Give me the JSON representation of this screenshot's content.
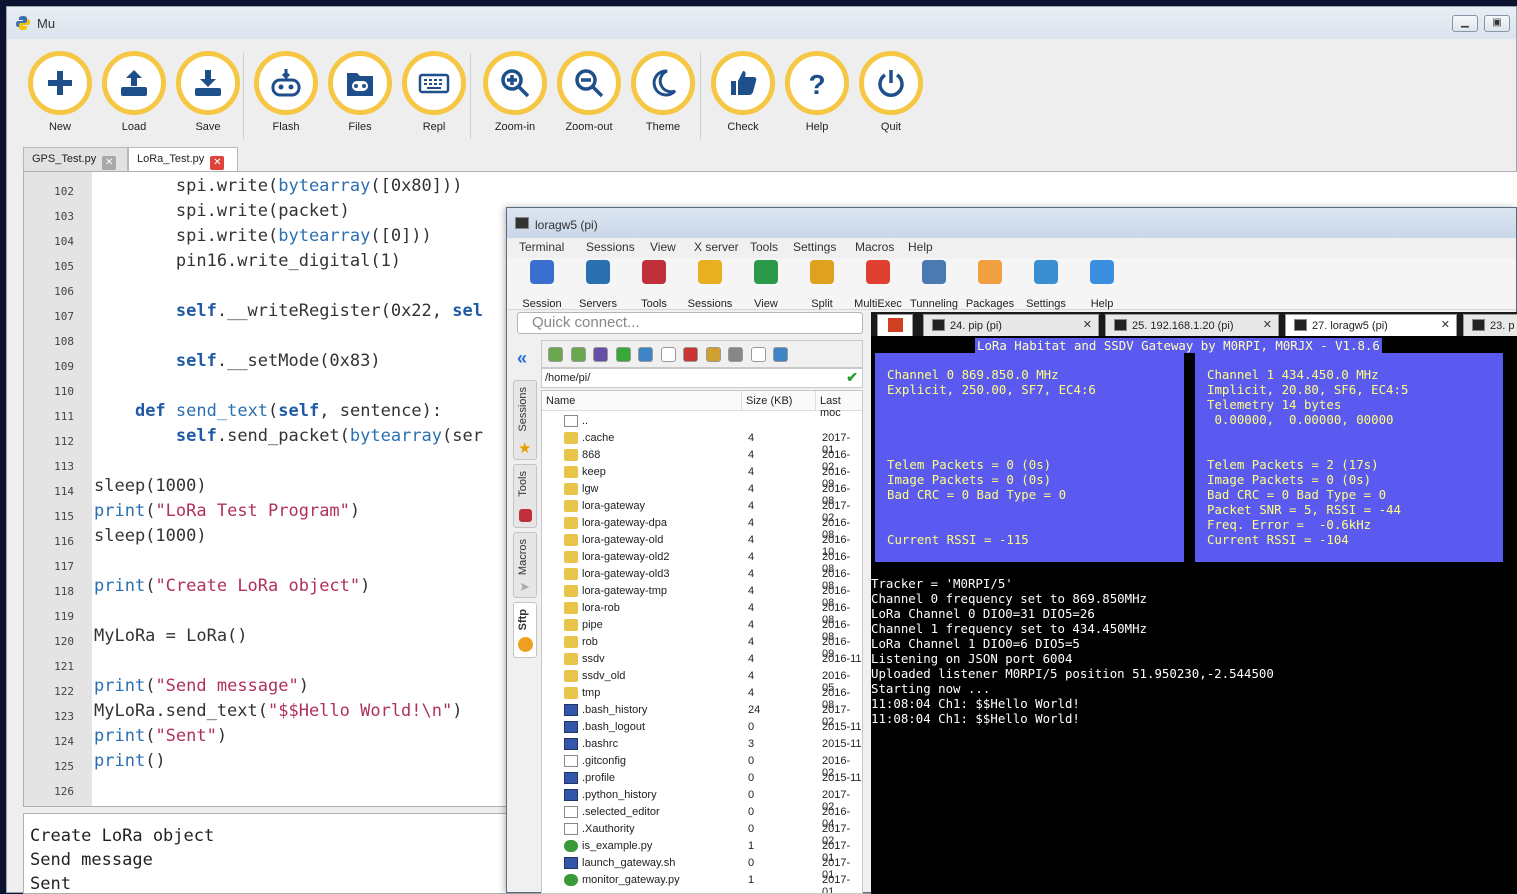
{
  "mu": {
    "title": "Mu",
    "toolbar": [
      {
        "id": "new",
        "label": "New",
        "icon": "plus-icon"
      },
      {
        "id": "load",
        "label": "Load",
        "icon": "upload-icon"
      },
      {
        "id": "save",
        "label": "Save",
        "icon": "download-icon"
      },
      {
        "id": "flash",
        "label": "Flash",
        "icon": "microbit-flash-icon"
      },
      {
        "id": "files",
        "label": "Files",
        "icon": "microbit-files-icon"
      },
      {
        "id": "repl",
        "label": "Repl",
        "icon": "keyboard-icon"
      },
      {
        "id": "zoomin",
        "label": "Zoom-in",
        "icon": "zoom-in-icon"
      },
      {
        "id": "zoomout",
        "label": "Zoom-out",
        "icon": "zoom-out-icon"
      },
      {
        "id": "theme",
        "label": "Theme",
        "icon": "moon-icon"
      },
      {
        "id": "check",
        "label": "Check",
        "icon": "thumbs-up-icon"
      },
      {
        "id": "help",
        "label": "Help",
        "icon": "question-icon"
      },
      {
        "id": "quit",
        "label": "Quit",
        "icon": "power-icon"
      }
    ],
    "tabs": [
      {
        "label": "GPS_Test.py"
      },
      {
        "label": "LoRa_Test.py"
      }
    ],
    "line_numbers": [
      "102",
      "103",
      "104",
      "105",
      "106",
      "107",
      "108",
      "109",
      "110",
      "111",
      "112",
      "113",
      "114",
      "115",
      "116",
      "117",
      "118",
      "119",
      "120",
      "121",
      "122",
      "123",
      "124",
      "125",
      "126"
    ],
    "repl_lines": [
      "Create LoRa object",
      "Send message",
      "Sent"
    ]
  },
  "moba": {
    "title": "loragw5 (pi)",
    "menu": [
      "Terminal",
      "Sessions",
      "View",
      "X server",
      "Tools",
      "Settings",
      "Macros",
      "Help"
    ],
    "tools": [
      "Session",
      "Servers",
      "Tools",
      "Sessions",
      "View",
      "Split",
      "MultiExec",
      "Tunneling",
      "Packages",
      "Settings",
      "Help"
    ],
    "quick_connect_placeholder": "Quick connect...",
    "side_tabs": [
      "Sessions",
      "Tools",
      "Macros",
      "Sftp"
    ],
    "path": "/home/pi/",
    "file_headers": {
      "name": "Name",
      "size": "Size (KB)",
      "modified": "Last moc"
    },
    "files": [
      {
        "name": "..",
        "size": "",
        "date": "",
        "type": "file"
      },
      {
        "name": ".cache",
        "size": "4",
        "date": "2017-01",
        "type": "folder"
      },
      {
        "name": "868",
        "size": "4",
        "date": "2016-02",
        "type": "folder"
      },
      {
        "name": "keep",
        "size": "4",
        "date": "2016-09",
        "type": "folder"
      },
      {
        "name": "lgw",
        "size": "4",
        "date": "2016-08",
        "type": "folder"
      },
      {
        "name": "lora-gateway",
        "size": "4",
        "date": "2017-02",
        "type": "folder"
      },
      {
        "name": "lora-gateway-dpa",
        "size": "4",
        "date": "2016-08",
        "type": "folder"
      },
      {
        "name": "lora-gateway-old",
        "size": "4",
        "date": "2016-10",
        "type": "folder"
      },
      {
        "name": "lora-gateway-old2",
        "size": "4",
        "date": "2016-08",
        "type": "folder"
      },
      {
        "name": "lora-gateway-old3",
        "size": "4",
        "date": "2016-08",
        "type": "folder"
      },
      {
        "name": "lora-gateway-tmp",
        "size": "4",
        "date": "2016-08",
        "type": "folder"
      },
      {
        "name": "lora-rob",
        "size": "4",
        "date": "2016-08",
        "type": "folder"
      },
      {
        "name": "pipe",
        "size": "4",
        "date": "2016-08",
        "type": "folder"
      },
      {
        "name": "rob",
        "size": "4",
        "date": "2016-09",
        "type": "folder"
      },
      {
        "name": "ssdv",
        "size": "4",
        "date": "2016-11",
        "type": "folder"
      },
      {
        "name": "ssdv_old",
        "size": "4",
        "date": "2016-05",
        "type": "folder"
      },
      {
        "name": "tmp",
        "size": "4",
        "date": "2016-08",
        "type": "folder"
      },
      {
        "name": ".bash_history",
        "size": "24",
        "date": "2017-02",
        "type": "doc"
      },
      {
        "name": ".bash_logout",
        "size": "0",
        "date": "2015-11",
        "type": "doc"
      },
      {
        "name": ".bashrc",
        "size": "3",
        "date": "2015-11",
        "type": "doc"
      },
      {
        "name": ".gitconfig",
        "size": "0",
        "date": "2016-02",
        "type": "file"
      },
      {
        "name": ".profile",
        "size": "0",
        "date": "2015-11",
        "type": "doc"
      },
      {
        "name": ".python_history",
        "size": "0",
        "date": "2017-02",
        "type": "doc"
      },
      {
        "name": ".selected_editor",
        "size": "0",
        "date": "2016-04",
        "type": "file"
      },
      {
        "name": ".Xauthority",
        "size": "0",
        "date": "2017-02",
        "type": "file"
      },
      {
        "name": "is_example.py",
        "size": "1",
        "date": "2017-01",
        "type": "py"
      },
      {
        "name": "launch_gateway.sh",
        "size": "0",
        "date": "2017-01",
        "type": "doc"
      },
      {
        "name": "monitor_gateway.py",
        "size": "1",
        "date": "2017-01",
        "type": "py"
      }
    ],
    "term_tabs": [
      "24. pip (pi)",
      "25. 192.168.1.20 (pi)",
      "27. loragw5 (pi)",
      "23. p"
    ],
    "term_header": "LoRa Habitat and SSDV Gateway by M0RPI, M0RJX - V1.8.6",
    "panel0": [
      "Channel 0 869.850.0 MHz",
      "Explicit, 250.00, SF7, EC4:6",
      "",
      "",
      "",
      "",
      "Telem Packets = 0 (0s)",
      "Image Packets = 0 (0s)",
      "Bad CRC = 0 Bad Type = 0",
      "",
      "",
      "Current RSSI = -115"
    ],
    "panel1": [
      "Channel 1 434.450.0 MHz",
      "Implicit, 20.80, SF6, EC4:5",
      "Telemetry 14 bytes",
      " 0.00000,  0.00000, 00000",
      "",
      "",
      "Telem Packets = 2 (17s)",
      "Image Packets = 0 (0s)",
      "Bad CRC = 0 Bad Type = 0",
      "Packet SNR = 5, RSSI = -44",
      "Freq. Error =  -0.6kHz",
      "Current RSSI = -104"
    ],
    "log": [
      "Tracker = 'M0RPI/5'",
      "Channel 0 frequency set to 869.850MHz",
      "LoRa Channel 0 DIO0=31 DIO5=26",
      "Channel 1 frequency set to 434.450MHz",
      "LoRa Channel 1 DIO0=6 DIO5=5",
      "Listening on JSON port 6004",
      "Uploaded listener M0RPI/5 position 51.950230,-2.544500",
      "Starting now ...",
      "11:08:04 Ch1: $$Hello World!",
      "11:08:04 Ch1: $$Hello World!"
    ]
  },
  "colors": {
    "accent": "#f6c744",
    "term_panel": "#5a5af0",
    "term_text": "#ffff80"
  }
}
